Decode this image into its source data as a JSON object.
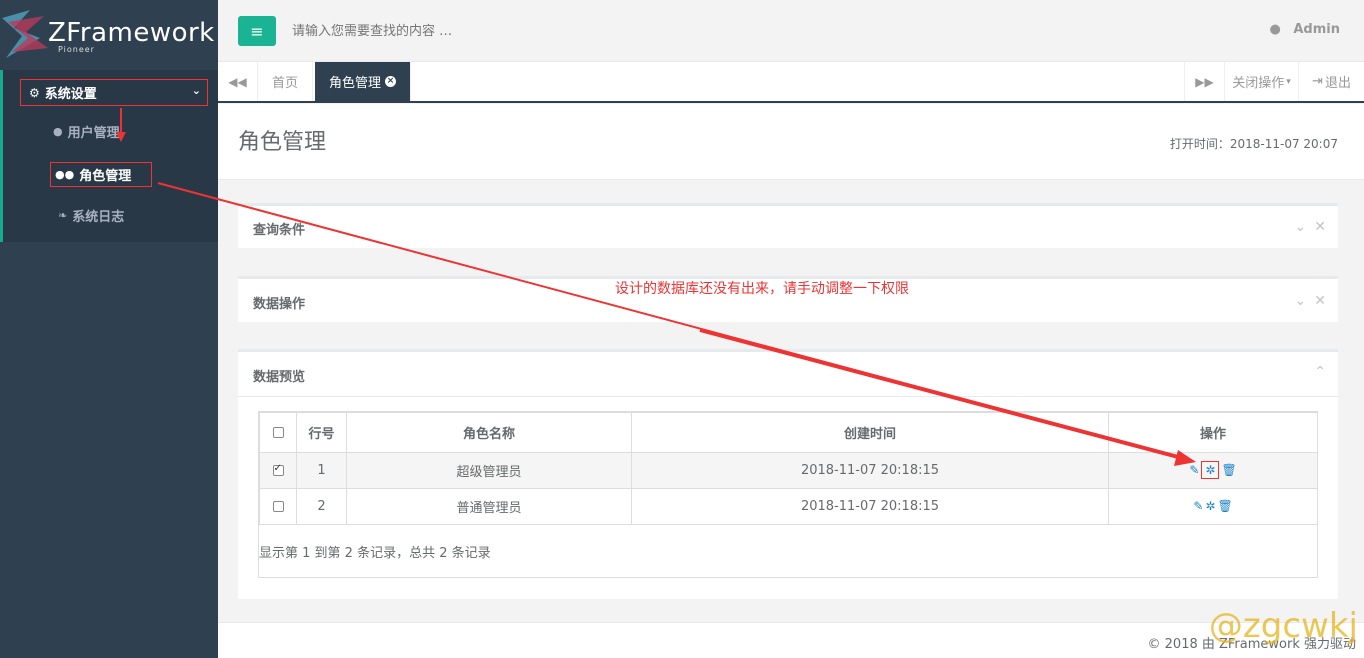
{
  "logo": {
    "title": "ZFramework",
    "subtitle": "Pioneer"
  },
  "sidebar": {
    "group_label": "系统设置",
    "items": [
      {
        "label": "用户管理",
        "icon": "user-icon"
      },
      {
        "label": "角色管理",
        "icon": "users-icon"
      },
      {
        "label": "系统日志",
        "icon": "leaf-icon"
      }
    ]
  },
  "topbar": {
    "search_placeholder": "请输入您需要查找的内容 …",
    "user": "Admin"
  },
  "tabs": {
    "home": "首页",
    "active": "角色管理",
    "close_ops": "关闭操作",
    "logout": "退出"
  },
  "page": {
    "title": "角色管理",
    "open_time": "打开时间：2018-11-07 20:07"
  },
  "panels": {
    "query": "查询条件",
    "operations": "数据操作",
    "preview": "数据预览"
  },
  "table": {
    "headers": [
      "行号",
      "角色名称",
      "创建时间",
      "操作"
    ],
    "rows": [
      {
        "no": "1",
        "name": "超级管理员",
        "created": "2018-11-07 20:18:15",
        "checked": true
      },
      {
        "no": "2",
        "name": "普通管理员",
        "created": "2018-11-07 20:18:15",
        "checked": false
      }
    ],
    "footer": "显示第 1 到第 2 条记录，总共 2 条记录"
  },
  "annotation": "设计的数据库还没有出来，请手动调整一下权限",
  "footer": {
    "text": "© 2018 由 ZFramework 强力驱动"
  },
  "watermark": "@zgcwkj",
  "colors": {
    "sidebar": "#2f4050",
    "accent": "#1ab394",
    "link": "#1c84c6",
    "annotation": "#e33333"
  }
}
